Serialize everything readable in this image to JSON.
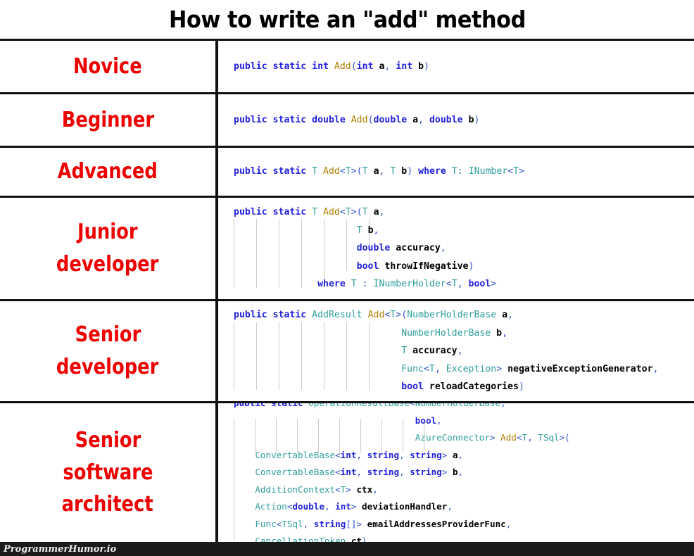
{
  "meme": {
    "title": "How to write an \"add\" method",
    "watermark": "ProgrammerHumor.io",
    "label_color": "#ee0000",
    "title_color": "#000000",
    "border_color": "#111111",
    "background_color": "#ffffff",
    "watermark_bar_color": "#1b1b1b",
    "code_colors": {
      "keyword": "#2222dd",
      "type": "#2f9e9e",
      "method": "#b08000",
      "plain": "#000000",
      "punctuation": "#3355cc"
    }
  },
  "rows": [
    {
      "label": "Novice",
      "label_lines": [
        "Novice"
      ],
      "code_lines": [
        "public static int Add(int a, int b)"
      ],
      "code_text": "public static int Add(int a, int b)"
    },
    {
      "label": "Beginner",
      "label_lines": [
        "Beginner"
      ],
      "code_lines": [
        "public static double Add(double a, double b)"
      ],
      "code_text": "public static double Add(double a, double b)"
    },
    {
      "label": "Advanced",
      "label_lines": [
        "Advanced"
      ],
      "code_lines": [
        "public static T Add<T>(T a, T b) where T: INumber<T>"
      ],
      "code_text": "public static T Add<T>(T a, T b) where T: INumber<T>"
    },
    {
      "label": "Junior developer",
      "label_lines": [
        "Junior",
        "developer"
      ],
      "code_lines": [
        "public static T Add<T>(T a,",
        "                      T b,",
        "                      double accuracy,",
        "                      bool throwIfNegative)",
        "               where T : INumberHolder<T, bool>"
      ],
      "code_text": "public static T Add<T>(T a,\n                      T b,\n                      double accuracy,\n                      bool throwIfNegative)\n               where T : INumberHolder<T, bool>"
    },
    {
      "label": "Senior developer",
      "label_lines": [
        "Senior",
        "developer"
      ],
      "code_lines": [
        "public static AddResult Add<T>(NumberHolderBase a,",
        "                              NumberHolderBase b,",
        "                              T accuracy,",
        "                              Func<T, Exception> negativeExceptionGenerator,",
        "                              bool reloadCategories)"
      ],
      "code_text": "public static AddResult Add<T>(NumberHolderBase a,\n                              NumberHolderBase b,\n                              T accuracy,\n                              Func<T, Exception> negativeExceptionGenerator,\n                              bool reloadCategories)"
    },
    {
      "label": "Senior software architect",
      "label_lines": [
        "Senior",
        "software",
        "architect"
      ],
      "code_lines": [
        "public static OperationResultBase<NumberHolderBase,",
        "                                  bool,",
        "                                  AzureConnector> Add<T, TSql>(",
        "    ConvertableBase<int, string, string> a,",
        "    ConvertableBase<int, string, string> b,",
        "    AdditionContext<T> ctx,",
        "    Action<double, int> deviationHandler,",
        "    Func<TSql, string[]> emailAddressesProviderFunc,",
        "    CancellationToken ct)"
      ],
      "code_text": "public static OperationResultBase<NumberHolderBase,\n                                  bool,\n                                  AzureConnector> Add<T, TSql>(\n    ConvertableBase<int, string, string> a,\n    ConvertableBase<int, string, string> b,\n    AdditionContext<T> ctx,\n    Action<double, int> deviationHandler,\n    Func<TSql, string[]> emailAddressesProviderFunc,\n    CancellationToken ct)"
    }
  ]
}
